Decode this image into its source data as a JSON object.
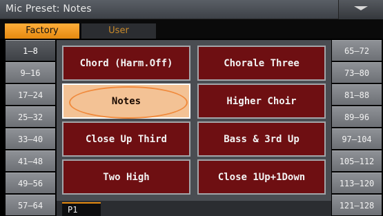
{
  "titlebar": {
    "title": "Mic Preset: Notes",
    "menu_icon": "chevron-down-icon"
  },
  "tabs": [
    {
      "label": "Factory",
      "selected": true
    },
    {
      "label": "User",
      "selected": false
    }
  ],
  "left_ranges": [
    {
      "label": "1–8",
      "selected": true
    },
    {
      "label": "9–16",
      "selected": false
    },
    {
      "label": "17–24",
      "selected": false
    },
    {
      "label": "25–32",
      "selected": false
    },
    {
      "label": "33–40",
      "selected": false
    },
    {
      "label": "41–48",
      "selected": false
    },
    {
      "label": "49–56",
      "selected": false
    },
    {
      "label": "57–64",
      "selected": false
    }
  ],
  "right_ranges": [
    {
      "label": "65–72"
    },
    {
      "label": "73–80"
    },
    {
      "label": "81–88"
    },
    {
      "label": "89–96"
    },
    {
      "label": "97–104"
    },
    {
      "label": "105–112"
    },
    {
      "label": "113–120"
    },
    {
      "label": "121–128"
    }
  ],
  "presets": [
    {
      "label": "Chord (Harm.Off)",
      "selected": false
    },
    {
      "label": "Chorale Three",
      "selected": false
    },
    {
      "label": "Notes",
      "selected": true
    },
    {
      "label": "Higher Choir",
      "selected": false
    },
    {
      "label": "Close Up Third",
      "selected": false
    },
    {
      "label": "Bass & 3rd Up",
      "selected": false
    },
    {
      "label": "Two High",
      "selected": false
    },
    {
      "label": "Close 1Up+1Down",
      "selected": false
    }
  ],
  "page": {
    "label": "P1"
  },
  "colors": {
    "accent": "#e58a10",
    "preset_bg": "#6e0f12",
    "selected_bg": "#f3c295"
  }
}
